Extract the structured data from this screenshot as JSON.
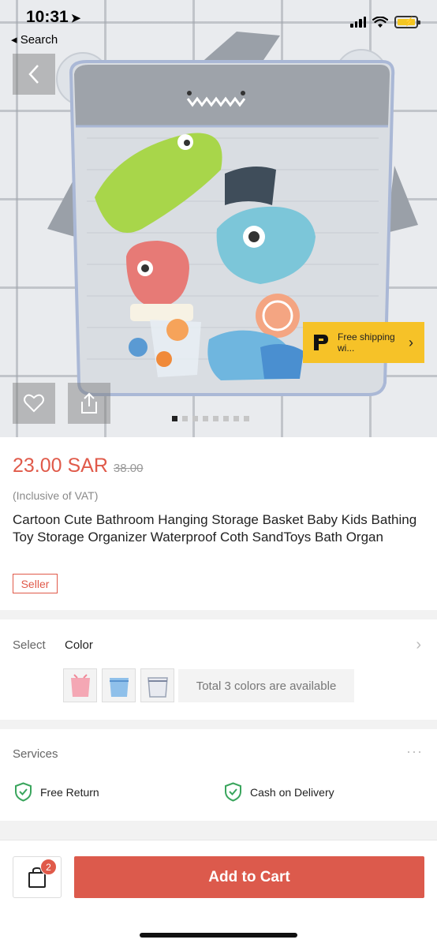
{
  "status_bar": {
    "time": "10:31",
    "location_arrow": "➤",
    "back_label": "◂ Search"
  },
  "gallery": {
    "image_alt": "Cartoon shark bath toy storage net",
    "free_shipping_text": "Free shipping wi...",
    "free_shipping_chevron": "›",
    "slide_count": 8,
    "active_slide": 1
  },
  "product": {
    "price": "23.00 SAR",
    "old_price": "38.00",
    "vat_note": "(Inclusive of VAT)",
    "title": "Cartoon Cute Bathroom Hanging Storage Basket Baby Kids Bathing Toy Storage Organizer Waterproof Coth SandToys Bath Organ",
    "seller_label": "Seller"
  },
  "select": {
    "label": "Select",
    "value": "Color",
    "chevron": "›",
    "swatches": [
      {
        "name": "pink",
        "color": "#f4a7b4"
      },
      {
        "name": "blue",
        "color": "#7fb4e6"
      },
      {
        "name": "gray",
        "color": "#9aa3b5"
      }
    ],
    "colors_note": "Total 3 colors are available"
  },
  "services": {
    "label": "Services",
    "more": "···",
    "items": [
      {
        "label": "Free Return",
        "icon": "shield-check-icon"
      },
      {
        "label": "Cash on Delivery",
        "icon": "shield-check-icon"
      }
    ]
  },
  "bottom_bar": {
    "cart_count": "2",
    "add_to_cart_label": "Add to Cart"
  },
  "colors": {
    "accent": "#dc5a4c",
    "price": "#e05a4a",
    "badge_yellow": "#f6c228",
    "check_green": "#3aa55d"
  }
}
